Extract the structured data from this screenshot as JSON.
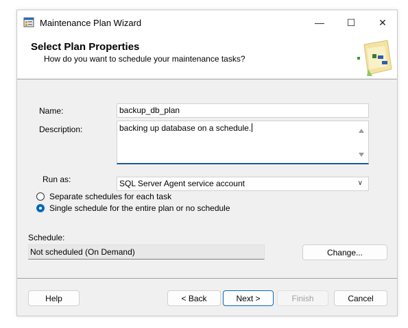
{
  "window": {
    "title": "Maintenance Plan Wizard",
    "app_icon": "wizard-app-icon",
    "controls": {
      "minimize": "—",
      "maximize": "☐",
      "close": "✕"
    }
  },
  "banner": {
    "title": "Select Plan Properties",
    "subtitle": "How do you want to schedule your maintenance tasks?",
    "art_icon": "maintenance-plan-graphic"
  },
  "form": {
    "name_label": "Name:",
    "name_value": "backup_db_plan",
    "description_label": "Description:",
    "description_value": "backing up database on a schedule.",
    "run_as_label": "Run as:",
    "run_as_value": "SQL Server Agent service account"
  },
  "schedule_options": [
    {
      "label": "Separate schedules for each task",
      "checked": false
    },
    {
      "label": "Single schedule for the entire plan or no schedule",
      "checked": true
    }
  ],
  "schedule": {
    "label": "Schedule:",
    "value": "Not scheduled (On Demand)",
    "change_button": "Change..."
  },
  "footer": {
    "help": "Help",
    "back": "< Back",
    "next": "Next >",
    "finish": "Finish",
    "cancel": "Cancel"
  },
  "colors": {
    "accent": "#0067c0",
    "focus_underline": "#1e5a96",
    "dialog_background": "#f0f0f0"
  }
}
